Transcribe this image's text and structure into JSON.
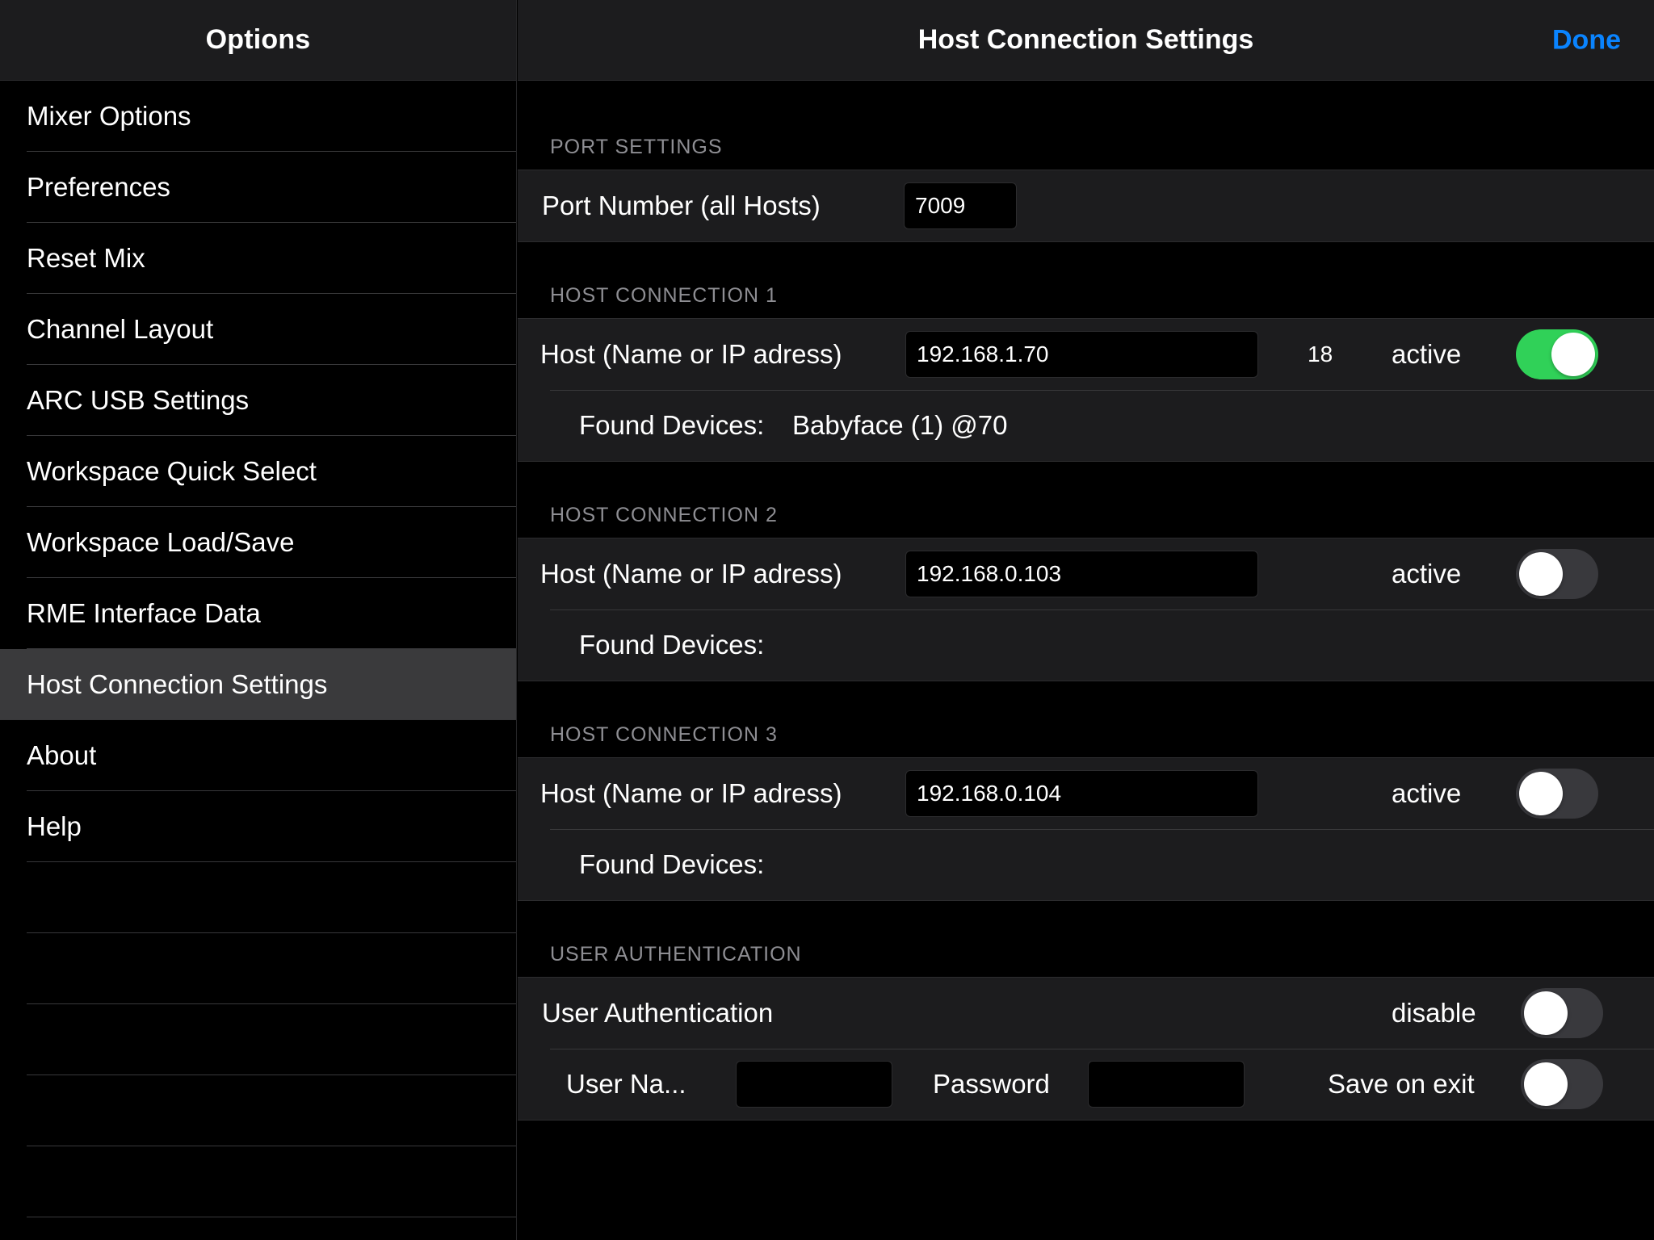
{
  "sidebar": {
    "title": "Options",
    "items": [
      {
        "label": "Mixer Options"
      },
      {
        "label": "Preferences"
      },
      {
        "label": "Reset Mix"
      },
      {
        "label": "Channel Layout"
      },
      {
        "label": "ARC USB Settings"
      },
      {
        "label": "Workspace Quick Select"
      },
      {
        "label": "Workspace Load/Save"
      },
      {
        "label": "RME Interface Data"
      },
      {
        "label": "Host Connection Settings",
        "selected": true
      },
      {
        "label": "About"
      },
      {
        "label": "Help"
      }
    ]
  },
  "nav": {
    "title": "Host Connection Settings",
    "done_label": "Done",
    "done_color": "#0a84ff"
  },
  "port_settings": {
    "header": "PORT SETTINGS",
    "label": "Port Number (all Hosts)",
    "value": "7009"
  },
  "hosts": [
    {
      "header": "HOST CONNECTION 1",
      "label": "Host (Name or IP adress)",
      "value": "192.168.1.70",
      "count": "18",
      "active_label": "active",
      "active": true,
      "found_label": "Found Devices:",
      "found_value": "Babyface (1) @70"
    },
    {
      "header": "HOST CONNECTION 2",
      "label": "Host (Name or IP adress)",
      "value": "192.168.0.103",
      "count": "",
      "active_label": "active",
      "active": false,
      "found_label": "Found Devices:",
      "found_value": ""
    },
    {
      "header": "HOST CONNECTION 3",
      "label": "Host (Name or IP adress)",
      "value": "192.168.0.104",
      "count": "",
      "active_label": "active",
      "active": false,
      "found_label": "Found Devices:",
      "found_value": ""
    }
  ],
  "auth": {
    "header": "USER AUTHENTICATION",
    "label": "User Authentication",
    "toggle_label": "disable",
    "enabled": false,
    "username_label": "User Na...",
    "username_value": "",
    "password_label": "Password",
    "password_value": "",
    "save_label": "Save on exit",
    "save_on_exit": false
  },
  "colors": {
    "toggle_on": "#30d158",
    "toggle_off": "#39393d"
  }
}
